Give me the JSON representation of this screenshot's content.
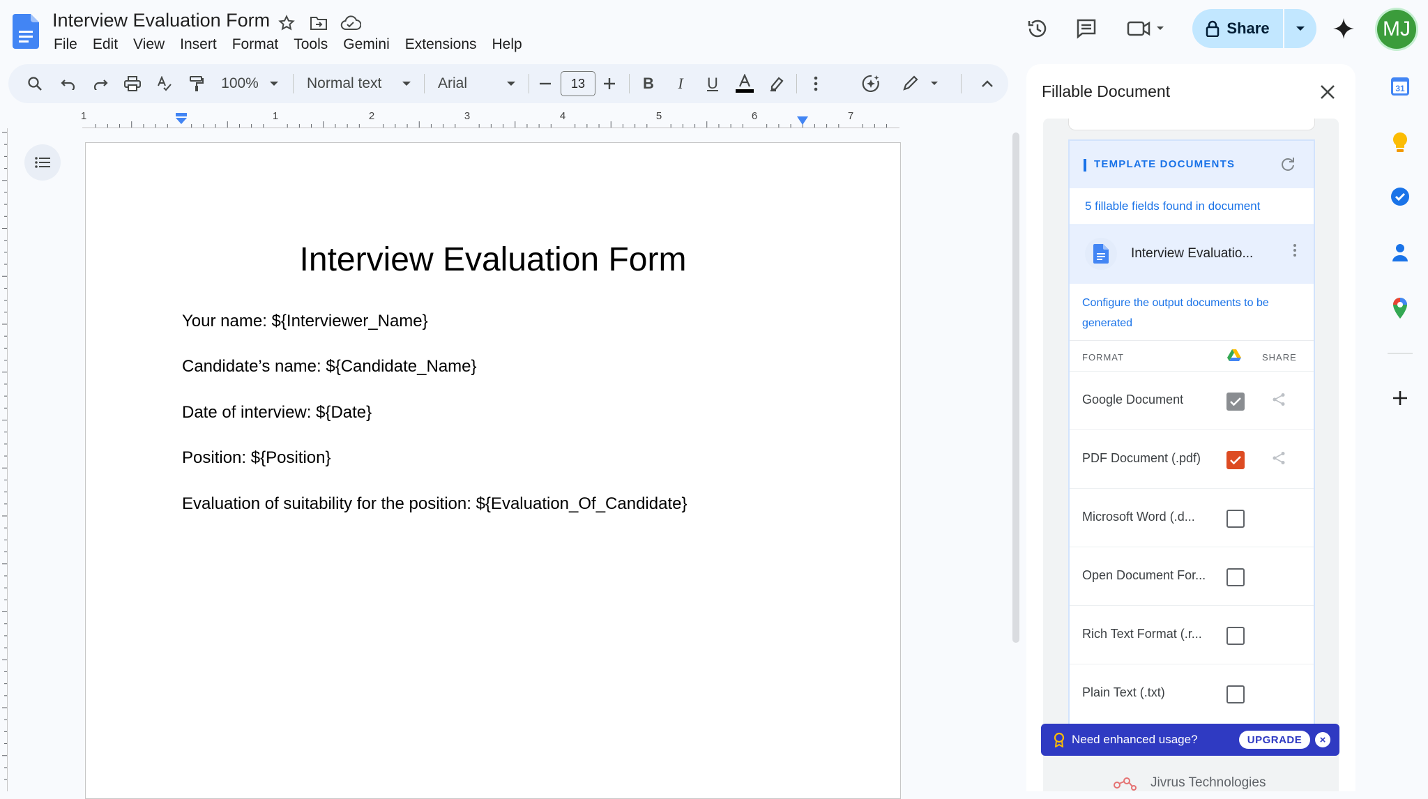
{
  "app": {
    "doc_title": "Interview Evaluation Form",
    "menu": [
      "File",
      "Edit",
      "View",
      "Insert",
      "Format",
      "Tools",
      "Gemini",
      "Extensions",
      "Help"
    ],
    "share_label": "Share",
    "avatar_initials": "MJ",
    "accent_color": "#1a73e8"
  },
  "toolbar": {
    "zoom": "100%",
    "style": "Normal text",
    "font": "Arial",
    "font_size": "13"
  },
  "ruler": {
    "labels": [
      "1",
      "1",
      "2",
      "3",
      "4",
      "5",
      "6",
      "7"
    ]
  },
  "document": {
    "heading": "Interview Evaluation Form",
    "lines": [
      "Your name: ${Interviewer_Name}",
      "Candidate’s name: ${Candidate_Name}",
      "Date of interview: ${Date}",
      "Position: ${Position}",
      "Evaluation of suitability for the position: ${Evaluation_Of_Candidate}"
    ]
  },
  "panel": {
    "title": "Fillable Document",
    "section_title": "TEMPLATE DOCUMENTS",
    "fields_found": "5 fillable fields found in document",
    "template_name": "Interview Evaluatio...",
    "config_text": "Configure the output documents to be generated",
    "format_header": "FORMAT",
    "share_header": "SHARE",
    "formats": [
      {
        "name": "Google Document",
        "checked": "checked-gray",
        "shareable": "yes"
      },
      {
        "name": "PDF Document (.pdf)",
        "checked": "checked-orange",
        "shareable": "yes"
      },
      {
        "name": "Microsoft Word (.d...",
        "checked": "unchecked",
        "shareable": "no"
      },
      {
        "name": "Open Document For...",
        "checked": "unchecked",
        "shareable": "no"
      },
      {
        "name": "Rich Text Format (.r...",
        "checked": "unchecked",
        "shareable": "no"
      },
      {
        "name": "Plain Text (.txt)",
        "checked": "unchecked",
        "shareable": "no"
      }
    ],
    "upgrade_prompt": "Need enhanced usage?",
    "upgrade_label": "UPGRADE",
    "brand": "Jivrus Technologies"
  },
  "rail": {
    "calendar_day": "31",
    "icons": [
      "calendar-icon",
      "keep-icon",
      "tasks-icon",
      "contacts-icon",
      "maps-icon",
      "add-icon"
    ]
  }
}
